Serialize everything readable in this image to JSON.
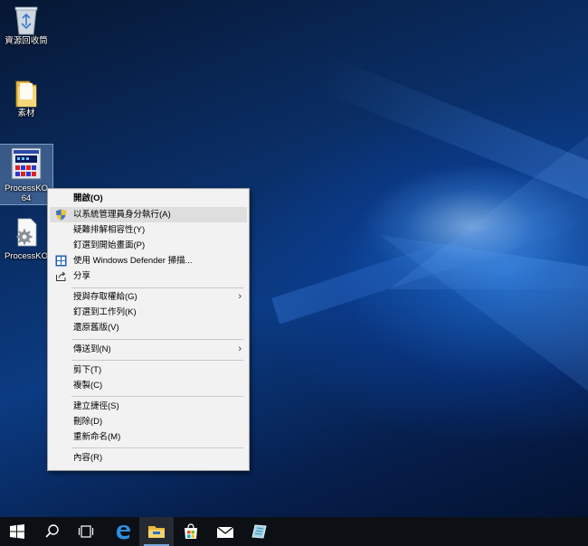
{
  "desktop": {
    "icons": [
      {
        "label": "資源回收筒",
        "icon": "recycle-bin-icon"
      },
      {
        "label": "素材",
        "icon": "folder-icon"
      },
      {
        "label": "ProcessKO\n64",
        "icon": "processko-app-icon"
      },
      {
        "label": "ProcessKO",
        "icon": "settings-file-icon"
      }
    ]
  },
  "context_menu": {
    "items": [
      {
        "label": "開啟(O)"
      },
      {
        "label": "以系統管理員身分執行(A)",
        "icon": "uac-shield-icon"
      },
      {
        "label": "疑難排解相容性(Y)"
      },
      {
        "label": "釘選到開始畫面(P)"
      },
      {
        "label": "使用 Windows Defender 掃描...",
        "icon": "windows-defender-icon"
      },
      {
        "label": "分享",
        "icon": "share-icon"
      },
      {
        "label": "授與存取權給(G)"
      },
      {
        "label": "釘選到工作列(K)"
      },
      {
        "label": "還原舊版(V)"
      },
      {
        "label": "傳送到(N)"
      },
      {
        "label": "剪下(T)"
      },
      {
        "label": "複製(C)"
      },
      {
        "label": "建立捷徑(S)"
      },
      {
        "label": "刪除(D)"
      },
      {
        "label": "重新命名(M)"
      },
      {
        "label": "內容(R)"
      }
    ]
  },
  "taskbar": {
    "buttons": [
      "start-icon",
      "search-icon",
      "task-view-icon",
      "edge-icon",
      "file-explorer-icon",
      "store-icon",
      "mail-icon",
      "app-icon"
    ]
  }
}
